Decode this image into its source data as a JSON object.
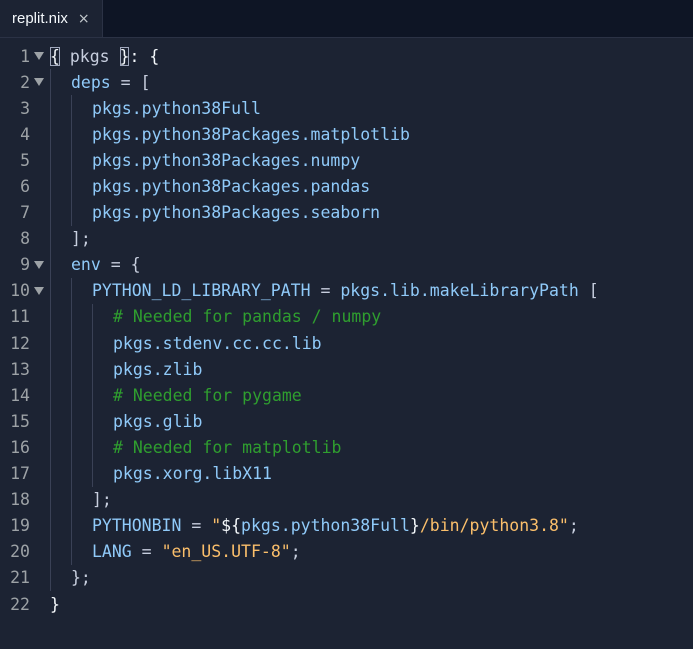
{
  "tab": {
    "label": "replit.nix",
    "close_glyph": "×"
  },
  "lines": [
    {
      "n": "1",
      "fold": true,
      "indent": 0,
      "tokens": [
        [
          "punct",
          "{"
        ],
        [
          "default",
          " pkgs "
        ],
        [
          "punct",
          "}"
        ],
        [
          "punct",
          ": {"
        ]
      ]
    },
    {
      "n": "2",
      "fold": true,
      "indent": 1,
      "tokens": [
        [
          "key",
          "deps"
        ],
        [
          "default",
          " = ["
        ]
      ]
    },
    {
      "n": "3",
      "fold": false,
      "indent": 2,
      "tokens": [
        [
          "key",
          "pkgs.python38Full"
        ]
      ]
    },
    {
      "n": "4",
      "fold": false,
      "indent": 2,
      "tokens": [
        [
          "key",
          "pkgs.python38Packages.matplotlib"
        ]
      ]
    },
    {
      "n": "5",
      "fold": false,
      "indent": 2,
      "tokens": [
        [
          "key",
          "pkgs.python38Packages.numpy"
        ]
      ]
    },
    {
      "n": "6",
      "fold": false,
      "indent": 2,
      "tokens": [
        [
          "key",
          "pkgs.python38Packages.pandas"
        ]
      ]
    },
    {
      "n": "7",
      "fold": false,
      "indent": 2,
      "tokens": [
        [
          "key",
          "pkgs.python38Packages.seaborn"
        ]
      ]
    },
    {
      "n": "8",
      "fold": false,
      "indent": 1,
      "tokens": [
        [
          "default",
          "];"
        ]
      ]
    },
    {
      "n": "9",
      "fold": true,
      "indent": 1,
      "tokens": [
        [
          "key",
          "env"
        ],
        [
          "default",
          " = {"
        ]
      ]
    },
    {
      "n": "10",
      "fold": true,
      "indent": 2,
      "tokens": [
        [
          "key",
          "PYTHON_LD_LIBRARY_PATH"
        ],
        [
          "default",
          " = "
        ],
        [
          "key",
          "pkgs.lib.makeLibraryPath"
        ],
        [
          "default",
          " ["
        ]
      ]
    },
    {
      "n": "11",
      "fold": false,
      "indent": 3,
      "tokens": [
        [
          "comment",
          "# Needed for pandas / numpy"
        ]
      ]
    },
    {
      "n": "12",
      "fold": false,
      "indent": 3,
      "tokens": [
        [
          "key",
          "pkgs.stdenv.cc.cc.lib"
        ]
      ]
    },
    {
      "n": "13",
      "fold": false,
      "indent": 3,
      "tokens": [
        [
          "key",
          "pkgs.zlib"
        ]
      ]
    },
    {
      "n": "14",
      "fold": false,
      "indent": 3,
      "tokens": [
        [
          "comment",
          "# Needed for pygame"
        ]
      ]
    },
    {
      "n": "15",
      "fold": false,
      "indent": 3,
      "tokens": [
        [
          "key",
          "pkgs.glib"
        ]
      ]
    },
    {
      "n": "16",
      "fold": false,
      "indent": 3,
      "tokens": [
        [
          "comment",
          "# Needed for matplotlib"
        ]
      ]
    },
    {
      "n": "17",
      "fold": false,
      "indent": 3,
      "tokens": [
        [
          "key",
          "pkgs.xorg.libX11"
        ]
      ]
    },
    {
      "n": "18",
      "fold": false,
      "indent": 2,
      "tokens": [
        [
          "default",
          "];"
        ]
      ]
    },
    {
      "n": "19",
      "fold": false,
      "indent": 2,
      "tokens": [
        [
          "key",
          "PYTHONBIN"
        ],
        [
          "default",
          " = "
        ],
        [
          "string",
          "\""
        ],
        [
          "punct",
          "${"
        ],
        [
          "key",
          "pkgs.python38Full"
        ],
        [
          "punct",
          "}"
        ],
        [
          "string",
          "/bin/python3.8\""
        ],
        [
          "default",
          ";"
        ]
      ]
    },
    {
      "n": "20",
      "fold": false,
      "indent": 2,
      "tokens": [
        [
          "key",
          "LANG"
        ],
        [
          "default",
          " = "
        ],
        [
          "string",
          "\"en_US.UTF-8\""
        ],
        [
          "default",
          ";"
        ]
      ]
    },
    {
      "n": "21",
      "fold": false,
      "indent": 1,
      "tokens": [
        [
          "default",
          "};"
        ]
      ]
    },
    {
      "n": "22",
      "fold": false,
      "indent": 0,
      "tokens": [
        [
          "punct",
          "}"
        ]
      ]
    }
  ],
  "colors": {
    "background": "#1c2333",
    "tabbar": "#0e1525",
    "comment": "#2f9e2f",
    "string": "#fbbf6b",
    "identifier": "#90caf9"
  },
  "icons": {
    "fold": "chevron-down-icon",
    "close": "close-icon"
  }
}
